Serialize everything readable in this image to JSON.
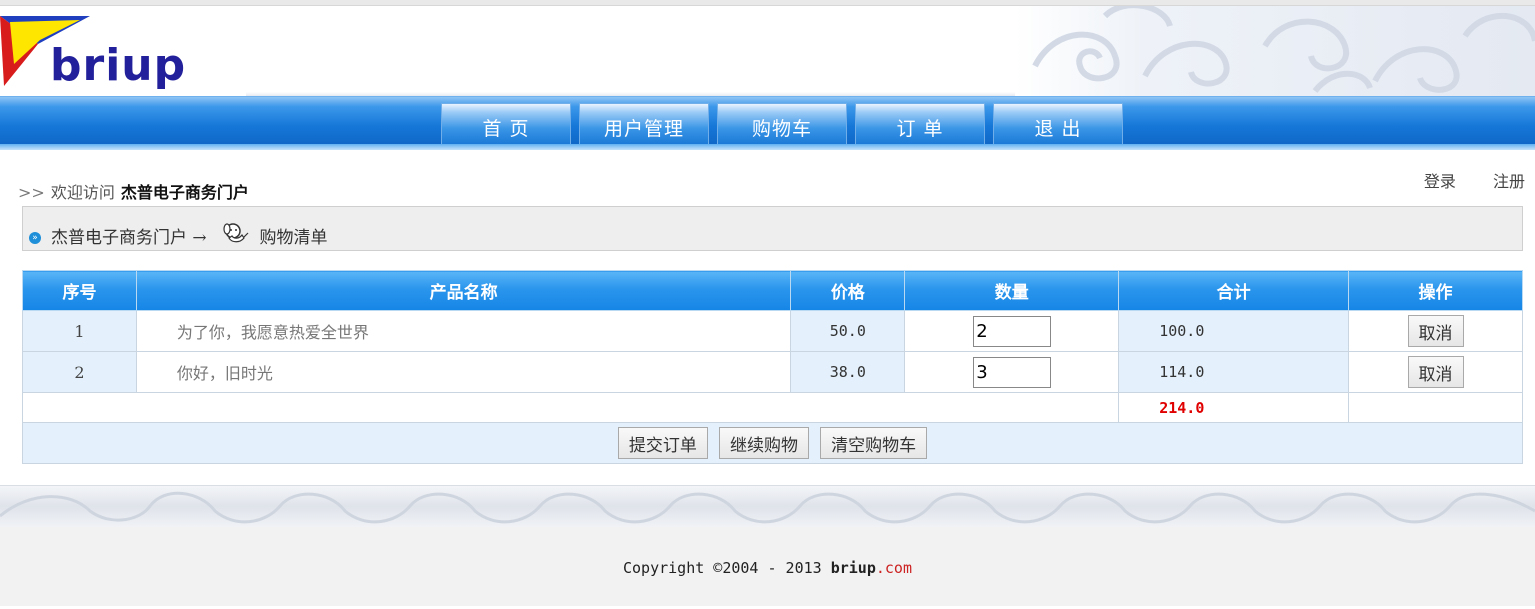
{
  "brand": {
    "logo_text": "briup"
  },
  "nav": {
    "items": [
      "首 页",
      "用户管理",
      "购物车",
      "订 单",
      "退 出"
    ]
  },
  "welcome": {
    "arrows": ">>",
    "text": "欢迎访问",
    "site": "杰普电子商务门户"
  },
  "auth": {
    "login": "登录",
    "register": "注册"
  },
  "breadcrumb": {
    "home": "杰普电子商务门户",
    "arrow": "→",
    "current": "购物清单"
  },
  "cart": {
    "headers": [
      "序号",
      "产品名称",
      "价格",
      "数量",
      "合计",
      "操作"
    ],
    "rows": [
      {
        "index": "1",
        "name": "为了你，我愿意热爱全世界",
        "price": "50.0",
        "qty": "2",
        "total": "100.0",
        "action": "取消"
      },
      {
        "index": "2",
        "name": "你好，旧时光",
        "price": "38.0",
        "qty": "3",
        "total": "114.0",
        "action": "取消"
      }
    ],
    "grand_total": "214.0",
    "buttons": {
      "submit": "提交订单",
      "continue": "继续购物",
      "clear": "清空购物车"
    }
  },
  "footer": {
    "copyright": "Copyright ©2004 - 2013 ",
    "brand": "briup",
    "tld": ".com"
  },
  "colors": {
    "nav_blue": "#1677d8",
    "header_cell_blue": "#2a95ec",
    "row_light_blue": "#e4f1fc",
    "grand_total_red": "#e00000"
  }
}
